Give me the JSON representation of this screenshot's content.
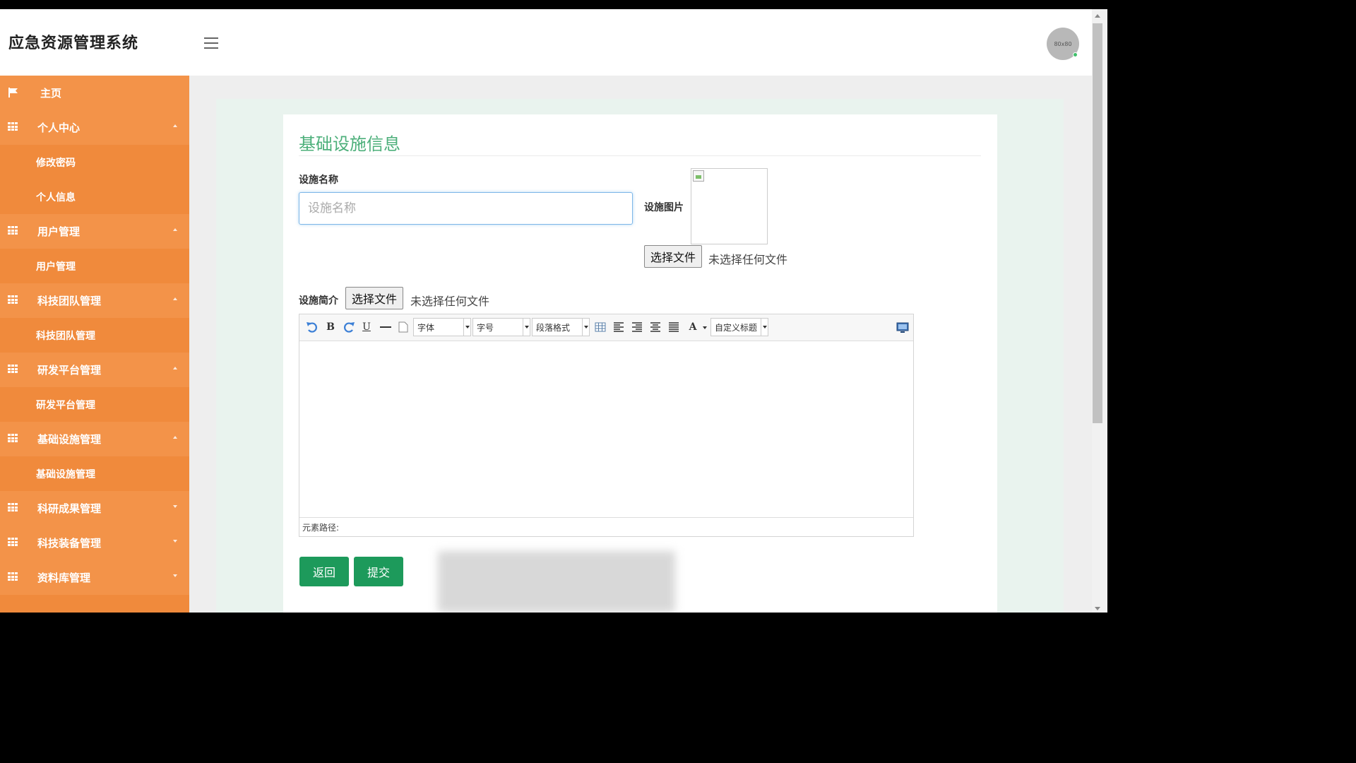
{
  "header": {
    "app_title": "应急资源管理系统",
    "avatar_text": "80x80"
  },
  "sidebar": {
    "items": [
      {
        "type": "top",
        "label": "主页",
        "icon": "flag-icon"
      },
      {
        "type": "group",
        "label": "个人中心",
        "icon": "grid-icon",
        "caret": "up"
      },
      {
        "type": "sub",
        "label": "修改密码"
      },
      {
        "type": "sub",
        "label": "个人信息"
      },
      {
        "type": "group",
        "label": "用户管理",
        "icon": "grid-icon",
        "caret": "up"
      },
      {
        "type": "sub",
        "label": "用户管理"
      },
      {
        "type": "group",
        "label": "科技团队管理",
        "icon": "grid-icon",
        "caret": "up"
      },
      {
        "type": "sub",
        "label": "科技团队管理"
      },
      {
        "type": "group",
        "label": "研发平台管理",
        "icon": "grid-icon",
        "caret": "up"
      },
      {
        "type": "sub",
        "label": "研发平台管理"
      },
      {
        "type": "group",
        "label": "基础设施管理",
        "icon": "grid-icon",
        "caret": "up"
      },
      {
        "type": "sub",
        "label": "基础设施管理"
      },
      {
        "type": "group",
        "label": "科研成果管理",
        "icon": "grid-icon",
        "caret": "down"
      },
      {
        "type": "group",
        "label": "科技装备管理",
        "icon": "grid-icon",
        "caret": "down"
      },
      {
        "type": "group",
        "label": "资料库管理",
        "icon": "grid-icon",
        "caret": "down"
      }
    ]
  },
  "form": {
    "title": "基础设施信息",
    "name_label": "设施名称",
    "name_placeholder": "设施名称",
    "name_value": "",
    "image_label": "设施图片",
    "image_file_button": "选择文件",
    "image_file_status": "未选择任何文件",
    "intro_label": "设施简介",
    "intro_file_button": "选择文件",
    "intro_file_status": "未选择任何文件"
  },
  "editor": {
    "toolbar": {
      "font_select": "字体",
      "size_select": "字号",
      "paragraph_select": "段落格式",
      "custom_title_select": "自定义标题",
      "bold": "B",
      "underline": "U",
      "font_color": "A"
    },
    "status_path": "元素路径:"
  },
  "actions": {
    "back_label": "返回",
    "submit_label": "提交"
  },
  "colors": {
    "sidebar": "#f08a3c",
    "accent_green": "#1d9a5b",
    "title_green": "#4caf7a"
  }
}
